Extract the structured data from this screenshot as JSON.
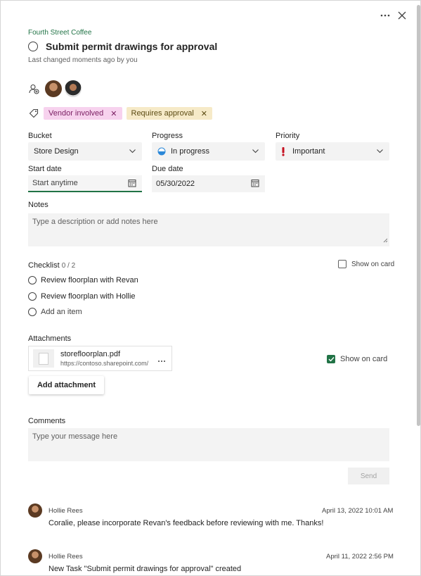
{
  "header": {
    "plan_name": "Fourth Street Coffee",
    "task_title": "Submit permit drawings for approval",
    "last_changed": "Last changed moments ago by you",
    "more_icon": "more-horizontal-icon",
    "close_icon": "close-icon"
  },
  "assignees": {
    "add_icon": "add-assignee-icon",
    "people": [
      "avatar",
      "avatar"
    ]
  },
  "labels": [
    {
      "text": "Vendor involved",
      "color": "#f7d2ee"
    },
    {
      "text": "Requires approval",
      "color": "#f6eac8"
    }
  ],
  "fields": {
    "bucket_label": "Bucket",
    "bucket_value": "Store Design",
    "progress_label": "Progress",
    "progress_value": "In progress",
    "priority_label": "Priority",
    "priority_value": "Important",
    "start_label": "Start date",
    "start_placeholder": "Start anytime",
    "due_label": "Due date",
    "due_value": "05/30/2022"
  },
  "notes": {
    "label": "Notes",
    "placeholder": "Type a description or add notes here"
  },
  "checklist": {
    "label": "Checklist",
    "count": "0 / 2",
    "show_on_card": "Show on card",
    "items": [
      "Review floorplan with Revan",
      "Review floorplan with Hollie"
    ],
    "add_item": "Add an item"
  },
  "attachments": {
    "label": "Attachments",
    "file_name": "storefloorplan.pdf",
    "file_url": "https://contoso.sharepoint.com/",
    "show_on_card": "Show on card",
    "add_button": "Add attachment"
  },
  "comments": {
    "label": "Comments",
    "placeholder": "Type your message here",
    "send": "Send",
    "items": [
      {
        "author": "Hollie Rees",
        "time": "April 13, 2022 10:01 AM",
        "text": "Coralie, please incorporate Revan's feedback before reviewing with me. Thanks!"
      },
      {
        "author": "Hollie Rees",
        "time": "April 11, 2022 2:56 PM",
        "text": "New Task \"Submit permit drawings for approval\" created"
      }
    ]
  },
  "colors": {
    "accent": "#217346",
    "important": "#c50f1f",
    "progress_blue": "#2b88d8"
  }
}
